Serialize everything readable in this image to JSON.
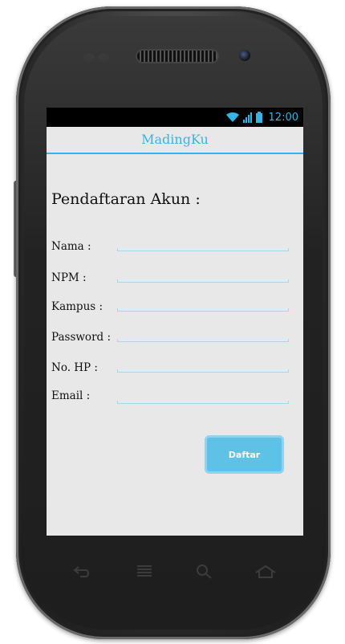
{
  "statusbar": {
    "time": "12:00"
  },
  "actionbar": {
    "title": "MadingKu"
  },
  "form": {
    "heading": "Pendaftaran Akun :",
    "fields": [
      {
        "label": "Nama :",
        "value": ""
      },
      {
        "label": "NPM :",
        "value": ""
      },
      {
        "label": "Kampus :",
        "value": ""
      },
      {
        "label": "Password :",
        "value": ""
      },
      {
        "label": "No. HP :",
        "value": ""
      },
      {
        "label": "Email :",
        "value": ""
      }
    ],
    "submit_label": "Daftar"
  },
  "colors": {
    "accent": "#33b5e5",
    "screen_bg": "#e8e8e8",
    "button": "#5ec1e6"
  },
  "device_keys": [
    "back-icon",
    "menu-icon",
    "search-icon",
    "home-icon"
  ]
}
